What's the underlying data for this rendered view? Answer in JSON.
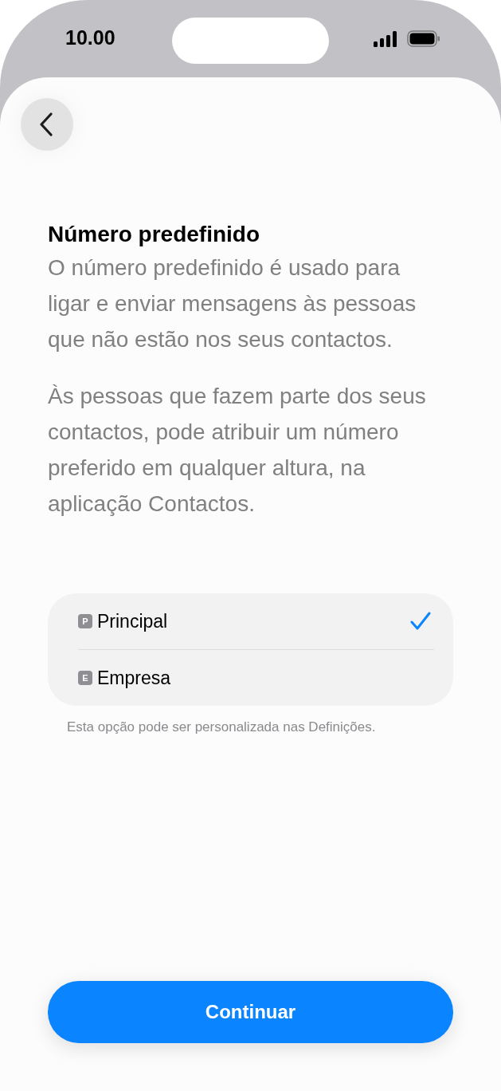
{
  "status_bar": {
    "time": "10.00"
  },
  "title": "Número predefinido",
  "paragraphs": [
    "O número predefinido é usado para ligar e enviar mensagens às pessoas que não estão nos seus contactos.",
    "Às pessoas que fazem parte dos seus contactos, pode atribuir um número preferido em qualquer altura, na aplicação Contactos."
  ],
  "options": [
    {
      "badge": "P",
      "label": "Principal",
      "selected": true
    },
    {
      "badge": "E",
      "label": "Empresa",
      "selected": false
    }
  ],
  "footnote": "Esta opção pode ser personalizada nas Definições.",
  "button": "Continuar"
}
